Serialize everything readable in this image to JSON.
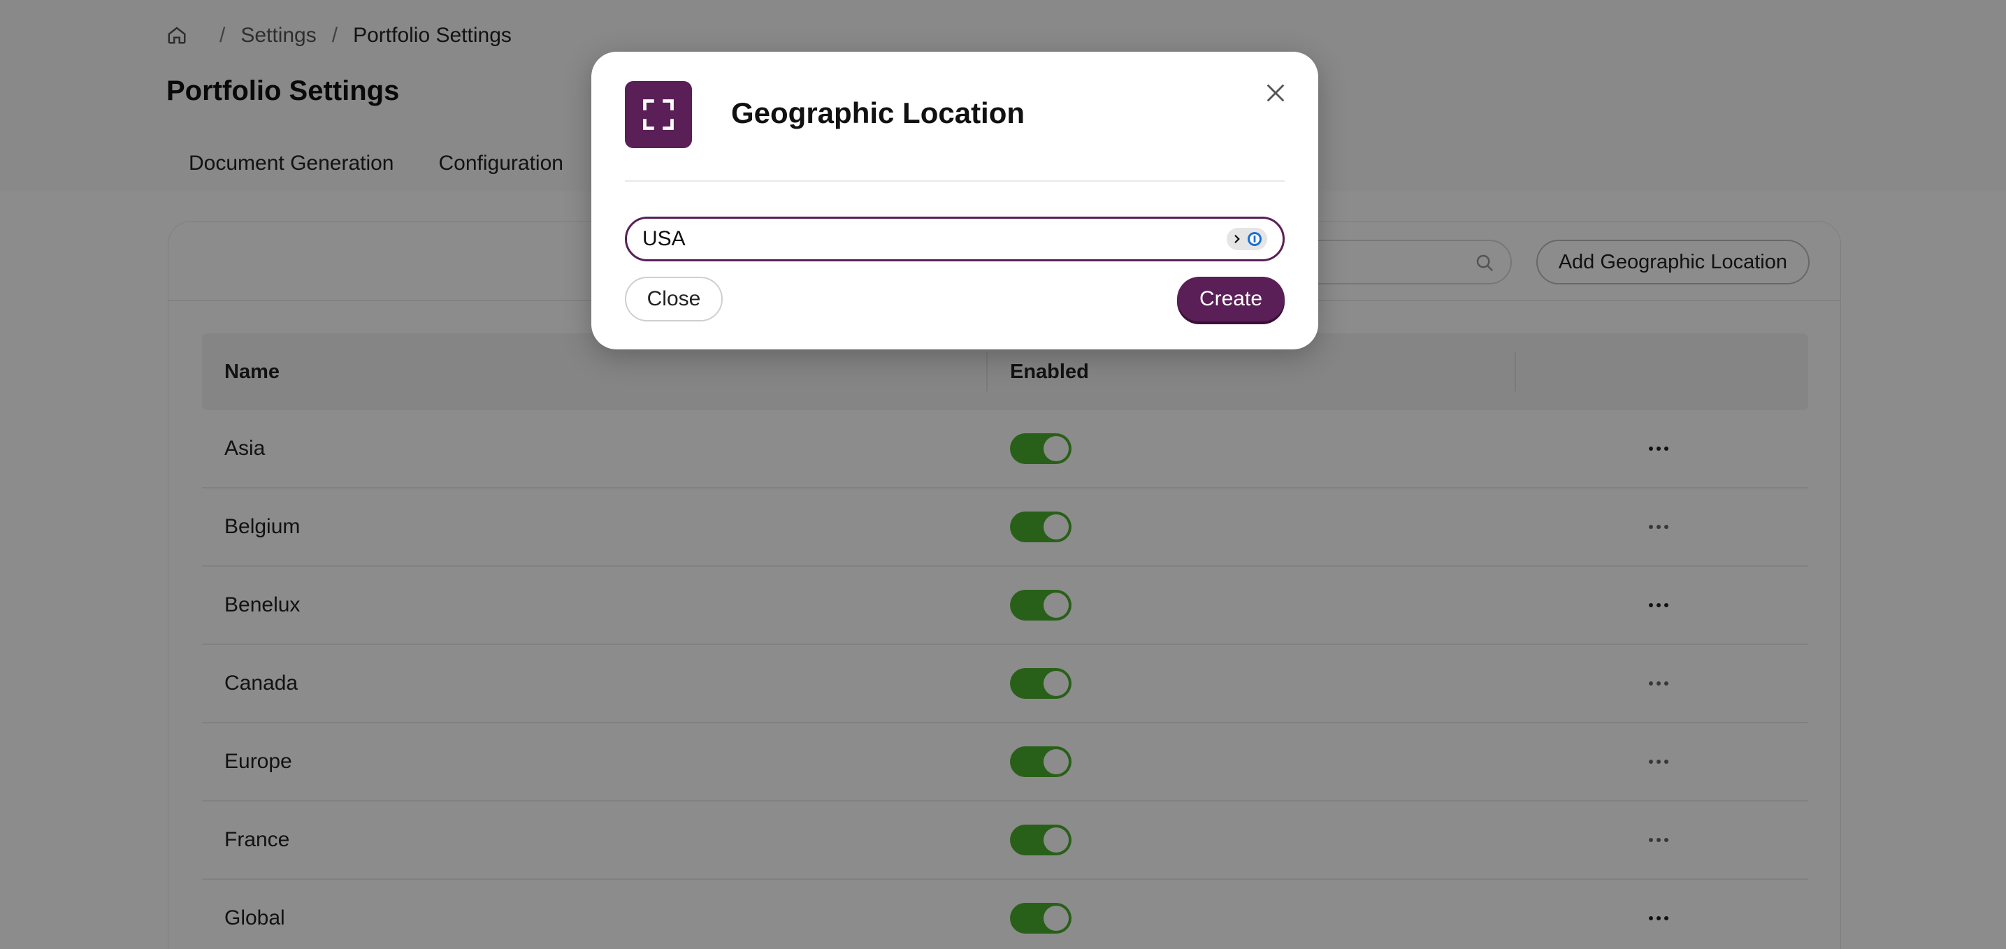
{
  "breadcrumb": {
    "home_icon": "home-icon",
    "settings": "Settings",
    "current": "Portfolio Settings",
    "sep": "/"
  },
  "page": {
    "title": "Portfolio Settings"
  },
  "tabs": [
    {
      "label": "Document Generation"
    },
    {
      "label": "Configuration"
    }
  ],
  "toolbar": {
    "search_placeholder": "",
    "search_icon": "search-icon",
    "add_label": "Add Geographic Location"
  },
  "table": {
    "columns": {
      "name": "Name",
      "enabled": "Enabled"
    },
    "rows": [
      {
        "name": "Asia",
        "enabled": true
      },
      {
        "name": "Belgium",
        "enabled": true
      },
      {
        "name": "Benelux",
        "enabled": true
      },
      {
        "name": "Canada",
        "enabled": true
      },
      {
        "name": "Europe",
        "enabled": true
      },
      {
        "name": "France",
        "enabled": true
      },
      {
        "name": "Global",
        "enabled": true
      }
    ]
  },
  "modal": {
    "icon": "expand-frame-icon",
    "title": "Geographic Location",
    "input_value": "USA",
    "close_label": "Close",
    "create_label": "Create"
  },
  "colors": {
    "accent": "#5a1f57",
    "toggle_on": "#4caf2f"
  }
}
